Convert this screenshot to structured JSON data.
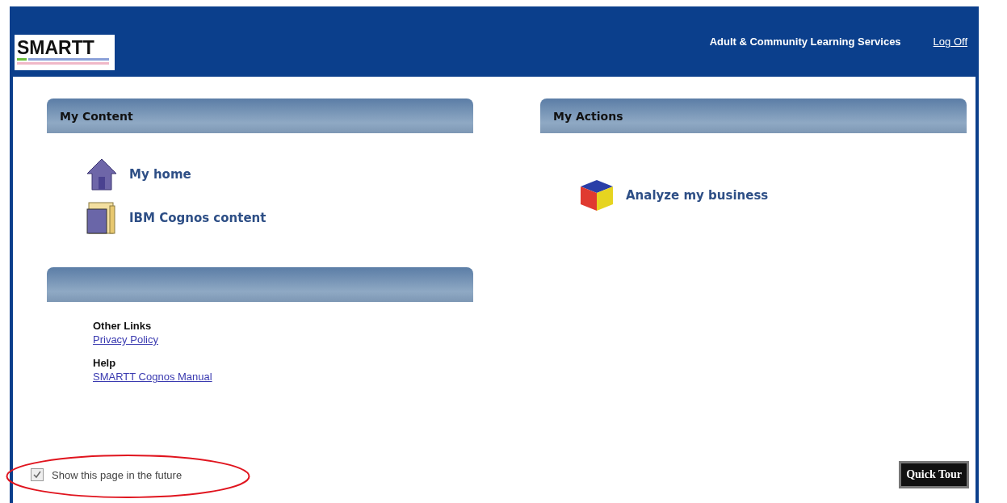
{
  "header": {
    "logo": "SMARTT",
    "organization": "Adult & Community Learning Services",
    "log_off": "Log Off"
  },
  "my_content": {
    "title": "My Content",
    "items": [
      {
        "kind": "home",
        "label": "My home"
      },
      {
        "kind": "folder",
        "label": "IBM Cognos content"
      }
    ]
  },
  "links_panel": {
    "groups": [
      {
        "heading": "Other Links",
        "link": "Privacy Policy"
      },
      {
        "heading": "Help",
        "link": "SMARTT Cognos Manual"
      }
    ]
  },
  "my_actions": {
    "title": "My Actions",
    "items": [
      {
        "kind": "cube",
        "label": "Analyze my business"
      }
    ]
  },
  "footer": {
    "show_page": {
      "label": "Show this page in the future",
      "checked": true,
      "highlighted": true
    },
    "quick_tour": "Quick Tour"
  }
}
